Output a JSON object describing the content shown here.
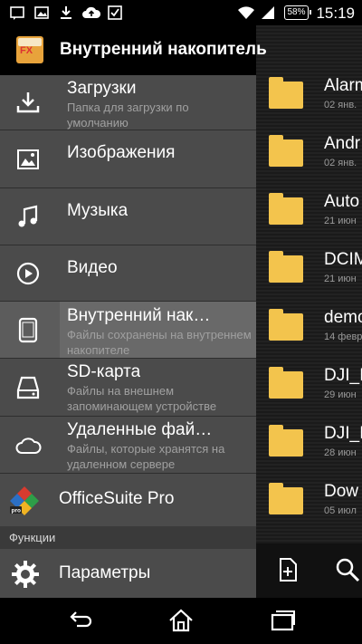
{
  "status_bar": {
    "time": "15:19",
    "battery": "58%",
    "icons": [
      "message-icon",
      "image-icon",
      "download-icon",
      "cloud-upload-icon",
      "checkbox-icon",
      "wifi-icon",
      "signal-icon"
    ]
  },
  "drawer": {
    "title": "Внутренний накопитель",
    "items": [
      {
        "label": "Загрузки",
        "sub": "Папка для загрузки по умолчанию",
        "icon": "download-icon"
      },
      {
        "label": "Изображения",
        "sub": "",
        "icon": "image-icon"
      },
      {
        "label": "Музыка",
        "sub": "",
        "icon": "music-note-icon"
      },
      {
        "label": "Видео",
        "sub": "",
        "icon": "play-circle-icon"
      },
      {
        "label": "Внутренний нак…",
        "sub": "Файлы сохранены на внутреннем накопителе",
        "icon": "tablet-icon"
      },
      {
        "label": "SD-карта",
        "sub": "Файлы на внешнем запоминающем устройстве",
        "icon": "drive-icon"
      },
      {
        "label": "Удаленные фай…",
        "sub": "Файлы, которые хранятся на удаленном сервере",
        "icon": "cloud-icon"
      },
      {
        "label": "OfficeSuite Pro",
        "sub": "",
        "icon": "officesuite-icon"
      }
    ],
    "section": "Функции",
    "settings_label": "Параметры"
  },
  "files": [
    {
      "name": "Alarm",
      "date": "02 янв."
    },
    {
      "name": "Andr",
      "date": "02 янв."
    },
    {
      "name": "Auto",
      "date": "21 июн"
    },
    {
      "name": "DCIM",
      "date": "21 июн"
    },
    {
      "name": "demo",
      "date": "14 февр"
    },
    {
      "name": "DJI_I",
      "date": "29 июн"
    },
    {
      "name": "DJI_I",
      "date": "28 июн"
    },
    {
      "name": "Dow",
      "date": "05 июл"
    }
  ],
  "colors": {
    "folder": "#f3c44d",
    "drawer_bg": "#4b4b4b",
    "active_bg": "#696969"
  }
}
